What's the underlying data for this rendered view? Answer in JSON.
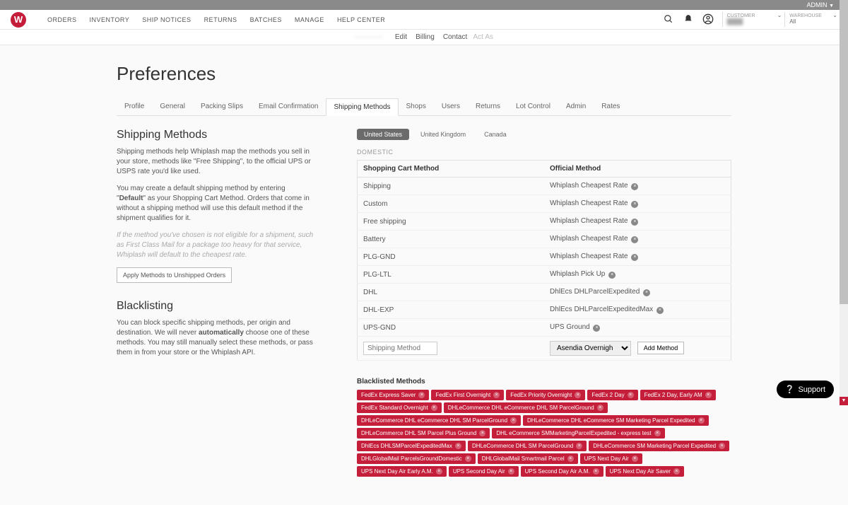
{
  "admin_bar": {
    "label": "ADMIN"
  },
  "logo": {
    "letter": "W"
  },
  "main_nav": [
    "ORDERS",
    "INVENTORY",
    "SHIP NOTICES",
    "RETURNS",
    "BATCHES",
    "MANAGE",
    "HELP CENTER"
  ],
  "account_boxes": {
    "customer": {
      "label": "CUSTOMER",
      "value": "—"
    },
    "warehouse": {
      "label": "WAREHOUSE",
      "value": "All"
    }
  },
  "sub_header": {
    "blurred": "————",
    "links": [
      "Edit",
      "Billing",
      "Contact"
    ],
    "muted": "Act As"
  },
  "page_title": "Preferences",
  "tabs": [
    "Profile",
    "General",
    "Packing Slips",
    "Email Confirmation",
    "Shipping Methods",
    "Shops",
    "Users",
    "Returns",
    "Lot Control",
    "Admin",
    "Rates"
  ],
  "active_tab": "Shipping Methods",
  "left": {
    "shipping_title": "Shipping Methods",
    "shipping_p1": "Shipping methods help Whiplash map the methods you sell in your store, methods like \"Free Shipping\", to the official UPS or USPS rate you'd like used.",
    "shipping_p2": "You may create a default shipping method by entering \"Default\" as your Shopping Cart Method. Orders that come in without a shipping method will use this default method if the shipment qualifies for it.",
    "shipping_em": "If the method you've chosen is not eligible for a shipment, such as First Class Mail for a package too heavy for that service, Whiplash will default to the cheapest rate.",
    "apply_btn": "Apply Methods to Unshipped Orders",
    "blacklist_title": "Blacklisting",
    "blacklist_p1": "You can block specific shipping methods, per origin and destination. We will never automatically choose one of these methods. You may still manually select these methods, or pass them in from your store or the Whiplash API.",
    "blacklist_bold": "automatically"
  },
  "regions": [
    "United States",
    "United Kingdom",
    "Canada"
  ],
  "active_region": "United States",
  "domestic_label": "DOMESTIC",
  "table": {
    "col1": "Shopping Cart Method",
    "col2": "Official Method",
    "rows": [
      {
        "cart": "Shipping",
        "official": "Whiplash Cheapest Rate"
      },
      {
        "cart": "Custom",
        "official": "Whiplash Cheapest Rate"
      },
      {
        "cart": "Free shipping",
        "official": "Whiplash Cheapest Rate"
      },
      {
        "cart": "Battery",
        "official": "Whiplash Cheapest Rate"
      },
      {
        "cart": "PLG-GND",
        "official": "Whiplash Cheapest Rate"
      },
      {
        "cart": "PLG-LTL",
        "official": "Whiplash Pick Up"
      },
      {
        "cart": "DHL",
        "official": "DhlEcs DHLParcelExpedited"
      },
      {
        "cart": "DHL-EXP",
        "official": "DhlEcs DHLParcelExpeditedMax"
      },
      {
        "cart": "UPS-GND",
        "official": "UPS Ground"
      }
    ],
    "input_placeholder": "Shipping Method",
    "select_value": "Asendia Overnigh",
    "add_btn": "Add Method"
  },
  "blacklist_label": "Blacklisted Methods",
  "blacklist_tags": [
    "FedEx Express Saver",
    "FedEx First Overnight",
    "FedEx Priority Overnight",
    "FedEx 2 Day",
    "FedEx 2 Day, Early AM",
    "FedEx Standard Overnight",
    "DHLeCommerce DHL eCommerce DHL SM ParcelGround",
    "DHLeCommerce DHL eCommerce DHL SM ParcelGround",
    "DHLeCommerce DHL eCommerce SM Marketing Parcel Expedited",
    "DHLeCommerce DHL SM Parcel Plus Ground",
    "DHL eCommerce SMMarketingParcelExpedited - express test",
    "DhlEcs DHLSMParcelExpeditedMax",
    "DHLeCommerce DHL SM ParcelGround",
    "DHLeCommerce SM Marketing Parcel Expedited",
    "DHLGlobalMail ParcelsGroundDomestic",
    "DHLGlobalMail Smartmail Parcel",
    "UPS Next Day Air",
    "UPS Next Day Air Early A.M.",
    "UPS Second Day Air",
    "UPS Second Day Air A.M.",
    "UPS Next Day Air Saver"
  ],
  "support_label": "Support"
}
